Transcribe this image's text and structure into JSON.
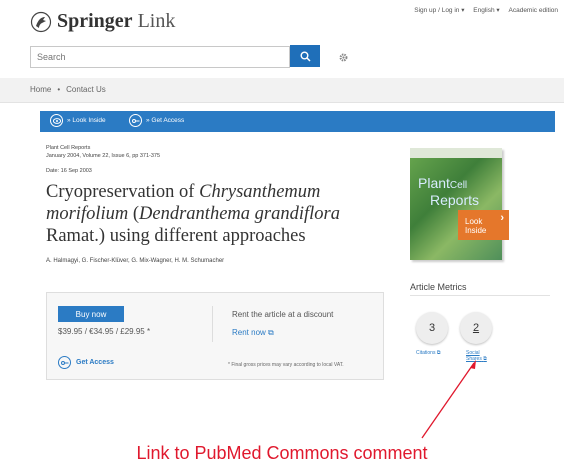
{
  "header": {
    "logo_bold": "Springer",
    "logo_light": "Link",
    "top_links": [
      "Sign up / Log in",
      "English",
      "Academic edition"
    ]
  },
  "search": {
    "placeholder": "Search"
  },
  "breadcrumb": [
    "Home",
    "Contact Us"
  ],
  "action_bar": {
    "look_inside": "» Look Inside",
    "get_access": "» Get Access"
  },
  "article": {
    "journal": "Plant Cell Reports",
    "issue": "January 2004, Volume 22, Issue 6, pp 371-375",
    "date": "Date: 16 Sep 2003",
    "title_part1": "Cryopreservation of ",
    "title_italic1": "Chrysanthemum morifolium",
    "title_part2": " (",
    "title_italic2": "Dendranthema grandiflora",
    "title_part3": " Ramat.) using different approaches",
    "authors": "A. Halmagyi, G. Fischer-Klüver, G. Mix-Wagner, H. M. Schumacher"
  },
  "purchase": {
    "buy_label": "Buy now",
    "prices": "$39.95 / €34.95 / £29.95 *",
    "rent_label": "Rent the article at a discount",
    "rent_link": "Rent now",
    "get_access": "Get Access",
    "vat_note": "* Final gross prices may vary according to local VAT."
  },
  "cover": {
    "title_line1": "Plant",
    "title_line2": "Cell",
    "title_line3": "Reports",
    "look_inside": "Look\nInside"
  },
  "metrics": {
    "title": "Article Metrics",
    "citations_count": "3",
    "citations_label": "Citations",
    "shares_count": "2",
    "shares_label_line1": "Social",
    "shares_label_line2": "Shares"
  },
  "annotation": {
    "text": "Link to PubMed Commons comment",
    "color": "#e0182d"
  },
  "colors": {
    "brand_blue": "#2b7bc4",
    "search_button": "#1f6fb9",
    "look_inside_orange": "#e5772b"
  }
}
